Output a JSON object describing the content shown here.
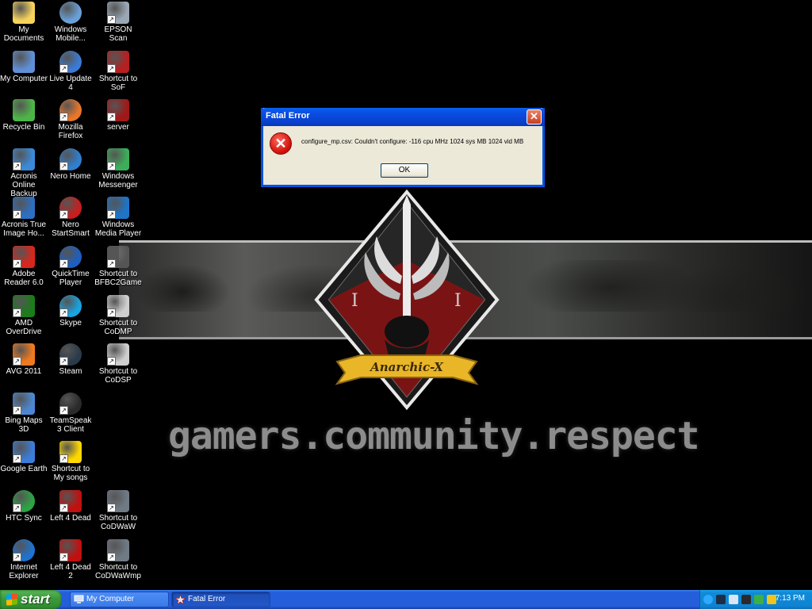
{
  "desktop": {
    "icons": [
      {
        "label": "My Documents"
      },
      {
        "label": "Windows Mobile..."
      },
      {
        "label": "EPSON Scan"
      },
      {
        "label": "My Computer"
      },
      {
        "label": "Live Update 4"
      },
      {
        "label": "Shortcut to SoF"
      },
      {
        "label": "Recycle Bin"
      },
      {
        "label": "Mozilla Firefox"
      },
      {
        "label": "server"
      },
      {
        "label": "Acronis Online Backup"
      },
      {
        "label": "Nero Home"
      },
      {
        "label": "Windows Messenger"
      },
      {
        "label": "Acronis True Image Ho..."
      },
      {
        "label": "Nero StartSmart"
      },
      {
        "label": "Windows Media Player"
      },
      {
        "label": "Adobe Reader 6.0"
      },
      {
        "label": "QuickTime Player"
      },
      {
        "label": "Shortcut to BFBC2Game"
      },
      {
        "label": "AMD OverDrive"
      },
      {
        "label": "Skype"
      },
      {
        "label": "Shortcut to CoDMP"
      },
      {
        "label": "AVG 2011"
      },
      {
        "label": "Steam"
      },
      {
        "label": "Shortcut to CoDSP"
      },
      {
        "label": "Bing Maps 3D"
      },
      {
        "label": "TeamSpeak 3 Client"
      },
      {
        "label": "Google Earth"
      },
      {
        "label": "Shortcut to My songs"
      },
      {
        "label": "HTC Sync"
      },
      {
        "label": "Left 4 Dead"
      },
      {
        "label": "Shortcut to CoDWaW"
      },
      {
        "label": "Internet Explorer"
      },
      {
        "label": "Left 4 Dead 2"
      },
      {
        "label": "Shortcut to CoDWaWmp"
      }
    ]
  },
  "wallpaper": {
    "emblem_text": "Anarchic-X",
    "emblem_left_mark": "I",
    "emblem_right_mark": "I",
    "slogan": "gamers.community.respect"
  },
  "dialog": {
    "title": "Fatal Error",
    "close_glyph": "✕",
    "icon_glyph": "✕",
    "message": "configure_mp.csv: Couldn't configure: -116 cpu MHz 1024 sys MB 1024 vid MB",
    "ok_label": "OK"
  },
  "taskbar": {
    "start_label": "start",
    "tasks": [
      {
        "label": "My Computer"
      },
      {
        "label": "Fatal Error"
      }
    ],
    "clock": "7:13 PM"
  }
}
